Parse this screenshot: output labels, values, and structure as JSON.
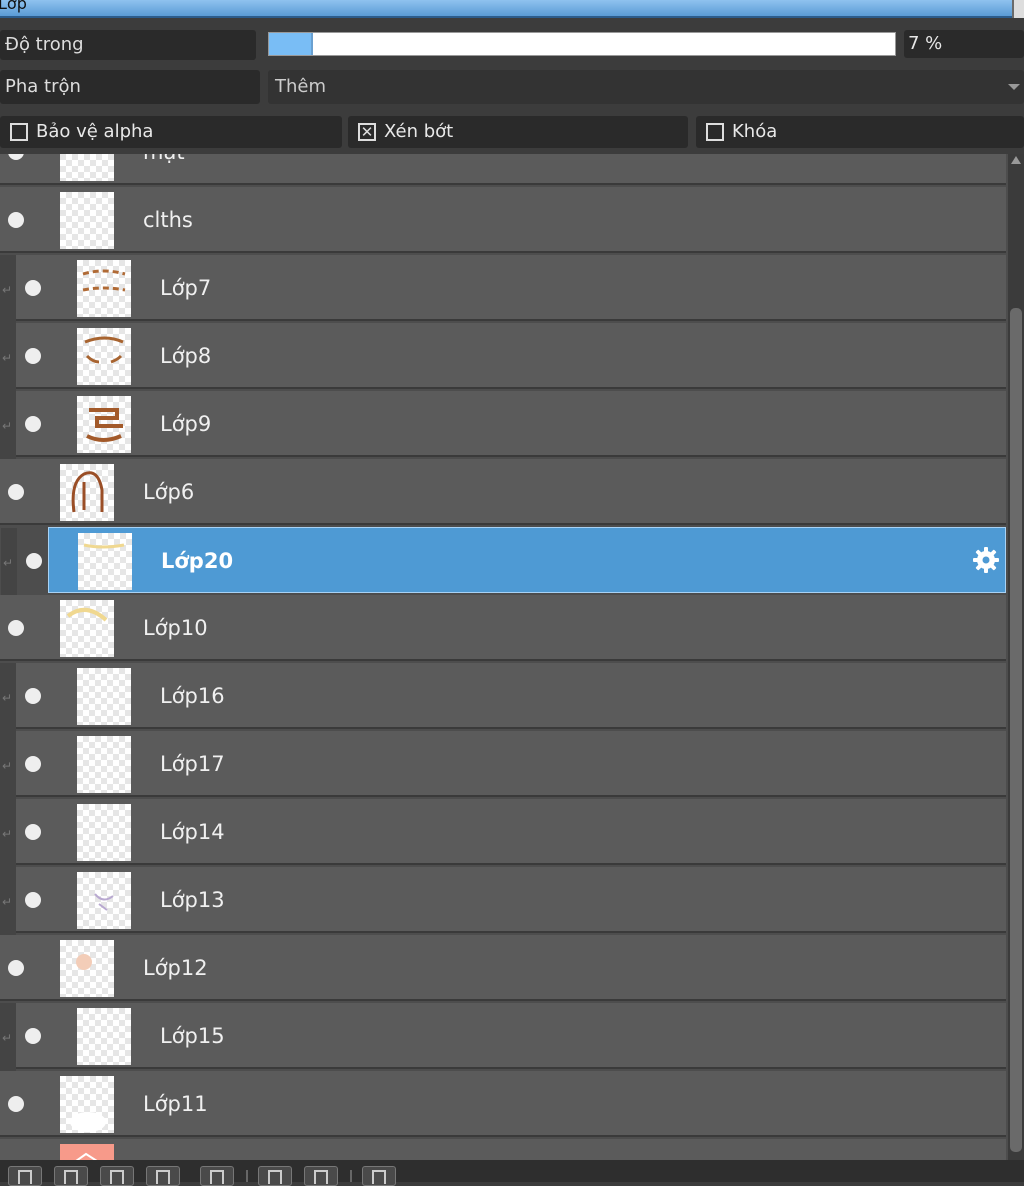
{
  "window": {
    "title": "Lớp"
  },
  "opacity": {
    "label": "Độ trong",
    "value_text": "7 %",
    "value_fraction": 0.07
  },
  "blend": {
    "label": "Pha trộn",
    "value": "Thêm"
  },
  "options": [
    {
      "label": "Bảo vệ alpha",
      "checked": false
    },
    {
      "label": "Xén bớt",
      "checked": true
    },
    {
      "label": "Khóa",
      "checked": false
    }
  ],
  "layers": [
    {
      "name": "mặt",
      "indent": false,
      "selected": false
    },
    {
      "name": "clths",
      "indent": false,
      "selected": false
    },
    {
      "name": "Lớp7",
      "indent": true,
      "selected": false
    },
    {
      "name": "Lớp8",
      "indent": true,
      "selected": false
    },
    {
      "name": "Lớp9",
      "indent": true,
      "selected": false
    },
    {
      "name": "Lớp6",
      "indent": false,
      "selected": false
    },
    {
      "name": "Lớp20",
      "indent": true,
      "selected": true
    },
    {
      "name": "Lớp10",
      "indent": false,
      "selected": false
    },
    {
      "name": "Lớp16",
      "indent": true,
      "selected": false
    },
    {
      "name": "Lớp17",
      "indent": true,
      "selected": false
    },
    {
      "name": "Lớp14",
      "indent": true,
      "selected": false
    },
    {
      "name": "Lớp13",
      "indent": true,
      "selected": false
    },
    {
      "name": "Lớp12",
      "indent": false,
      "selected": false
    },
    {
      "name": "Lớp15",
      "indent": true,
      "selected": false
    },
    {
      "name": "Lớp11",
      "indent": false,
      "selected": false
    },
    {
      "name": "",
      "indent": false,
      "selected": false
    }
  ],
  "icons": {
    "visibility": "eye-dot-icon",
    "clip": "clip-arrow-icon",
    "settings": "gear-icon"
  },
  "colors": {
    "selected_row": "#4e9ad4",
    "row": "#5b5b5b",
    "opacity_fill": "#79bdf5"
  }
}
